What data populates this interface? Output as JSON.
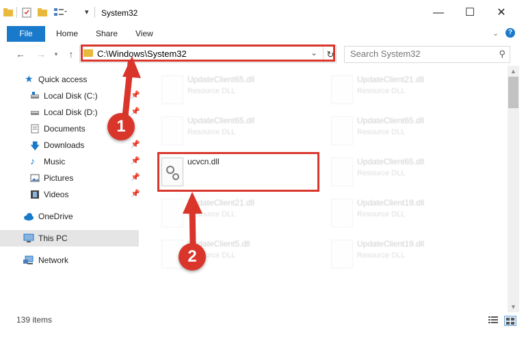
{
  "window": {
    "title": "System32",
    "minimize_icon": "minimize-icon",
    "maximize_icon": "maximize-icon",
    "close_icon": "close-icon"
  },
  "ribbon": {
    "tabs": [
      "File",
      "Home",
      "Share",
      "View"
    ],
    "expand_icon": "chevron-down-icon",
    "help_icon": "help-icon"
  },
  "nav": {
    "address": "C:\\Windows\\System32",
    "search_placeholder": "Search System32"
  },
  "sidebar": {
    "items": [
      {
        "label": "Quick access",
        "icon": "star-icon",
        "pinned": false
      },
      {
        "label": "Local Disk (C:)",
        "icon": "drive-icon",
        "pinned": true
      },
      {
        "label": "Local Disk (D:)",
        "icon": "drive-icon",
        "pinned": true
      },
      {
        "label": "Documents",
        "icon": "document-icon",
        "pinned": true
      },
      {
        "label": "Downloads",
        "icon": "download-icon",
        "pinned": true
      },
      {
        "label": "Music",
        "icon": "music-icon",
        "pinned": true
      },
      {
        "label": "Pictures",
        "icon": "pictures-icon",
        "pinned": true
      },
      {
        "label": "Videos",
        "icon": "videos-icon",
        "pinned": true
      },
      {
        "label": "OneDrive",
        "icon": "cloud-icon",
        "pinned": false
      },
      {
        "label": "This PC",
        "icon": "computer-icon",
        "pinned": false,
        "selected": true
      },
      {
        "label": "Network",
        "icon": "network-icon",
        "pinned": false
      }
    ]
  },
  "files": {
    "left": [
      {
        "name": "UpdateClient65.dll",
        "type": "Resource DLL"
      },
      {
        "name": "UpdateClient65.dll",
        "type": "Resource DLL"
      },
      {
        "name": "ucvcn.dll",
        "type": ""
      },
      {
        "name": "UpdateClient21.dll",
        "type": "Resource DLL"
      },
      {
        "name": "UpdateClient5.dll",
        "type": "Resource DLL"
      }
    ],
    "right": [
      {
        "name": "UpdateClient21.dll",
        "type": "Resource DLL"
      },
      {
        "name": "UpdateClient65.dll",
        "type": "Resource DLL"
      },
      {
        "name": "UpdateClient65.dll",
        "type": "Resource DLL"
      },
      {
        "name": "UpdateClient19.dll",
        "type": "Resource DLL"
      },
      {
        "name": "UpdateClient19.dll",
        "type": "Resource DLL"
      }
    ]
  },
  "status": {
    "item_count": "139 items"
  },
  "annotations": {
    "step1": "1",
    "step2": "2"
  },
  "colors": {
    "accent": "#1979ca",
    "highlight": "#d9352b",
    "folder": "#e8b93b"
  }
}
